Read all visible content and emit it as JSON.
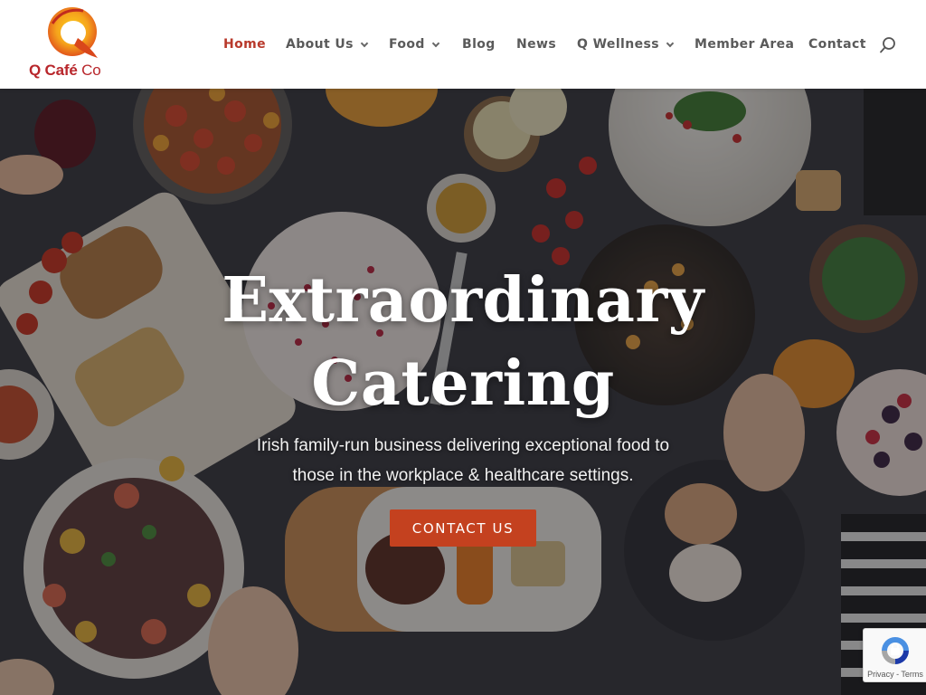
{
  "brand": {
    "name": "Q Café",
    "suffix": "Co",
    "colors": {
      "red": "#b8262b",
      "orange": "#f39a1e"
    }
  },
  "nav": {
    "items": [
      {
        "label": "Home",
        "active": true,
        "has_dropdown": false
      },
      {
        "label": "About Us",
        "active": false,
        "has_dropdown": true
      },
      {
        "label": "Food",
        "active": false,
        "has_dropdown": true
      },
      {
        "label": "Blog",
        "active": false,
        "has_dropdown": false
      },
      {
        "label": "News",
        "active": false,
        "has_dropdown": false
      },
      {
        "label": "Q Wellness",
        "active": false,
        "has_dropdown": true
      },
      {
        "label": "Member Area",
        "active": false,
        "has_dropdown": false
      },
      {
        "label": "Contact",
        "active": false,
        "has_dropdown": false
      }
    ],
    "search_icon": "search-icon",
    "active_color": "#b8392b",
    "text_color": "#5a5a5a"
  },
  "hero": {
    "title_line1": "Extraordinary",
    "title_line2": "Catering",
    "subtitle_line1": "Irish family-run business delivering exceptional food to",
    "subtitle_line2": "those in the workplace & healthcare settings.",
    "cta_label": "CONTACT US",
    "cta_color": "#c4411f"
  },
  "recaptcha": {
    "privacy": "Privacy",
    "separator": " - ",
    "terms": "Terms"
  }
}
